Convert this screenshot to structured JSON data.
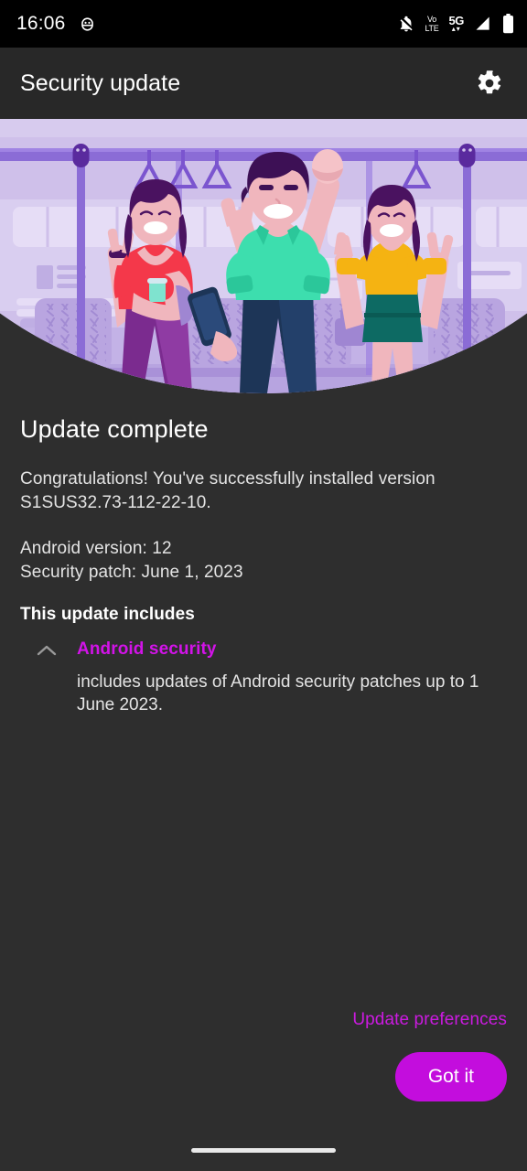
{
  "statusbar": {
    "time": "16:06",
    "icons": [
      {
        "name": "android-debug-icon",
        "glyph": "debug"
      },
      {
        "name": "notifications-off-icon",
        "glyph": "bell-muted"
      },
      {
        "name": "volte-icon",
        "line1": "Vo",
        "line2": "LTE"
      },
      {
        "name": "network-5g-icon",
        "label": "5G",
        "arrows": "▴▾"
      },
      {
        "name": "signal-strength-icon",
        "glyph": "signal"
      },
      {
        "name": "battery-icon",
        "glyph": "battery-full"
      }
    ]
  },
  "appbar": {
    "title": "Security update",
    "settings_icon": "gear-icon"
  },
  "hero": {
    "illustration_name": "subway-celebration-illustration",
    "alt": "Three people celebrating inside a subway train car",
    "colors": {
      "wall": "#cfc0ea",
      "wall_light": "#ded3f2",
      "rail": "#8b6cd6",
      "pole": "#8b6cd6",
      "seat": "#b9a5e0",
      "shirt_left": "#f4384a",
      "pants_left": "#7b2b8f",
      "shirt_center": "#3ddeae",
      "pants_center": "#1d3557",
      "shirt_right": "#f5b312",
      "skirt_right": "#0d6a63",
      "hair": "#4a1260",
      "skin": "#f0b6bd"
    }
  },
  "main": {
    "headline": "Update complete",
    "congrats": "Congratulations! You've successfully installed version S1SUS32.73-112-22-10.",
    "android_version": "Android version: 12",
    "security_patch": "Security patch: June 1, 2023",
    "section_title": "This update includes",
    "accordion": {
      "expand_icon": "chevron-up-icon",
      "title": "Android security",
      "description": "includes updates of Android security patches up to 1 June 2023.",
      "expanded": true
    }
  },
  "footer": {
    "preferences_link": "Update preferences",
    "primary_button": "Got it"
  },
  "navbar": {
    "gesture_pill": "home-gesture-pill"
  },
  "colors": {
    "background": "#2e2e2e",
    "appbar": "#282828",
    "statusbar": "#000000",
    "accent": "#c30ddd",
    "link": "#cb1ae0",
    "accordion_title": "#d213e8",
    "text_primary": "#ffffff",
    "text_secondary": "#e4e4e4"
  }
}
